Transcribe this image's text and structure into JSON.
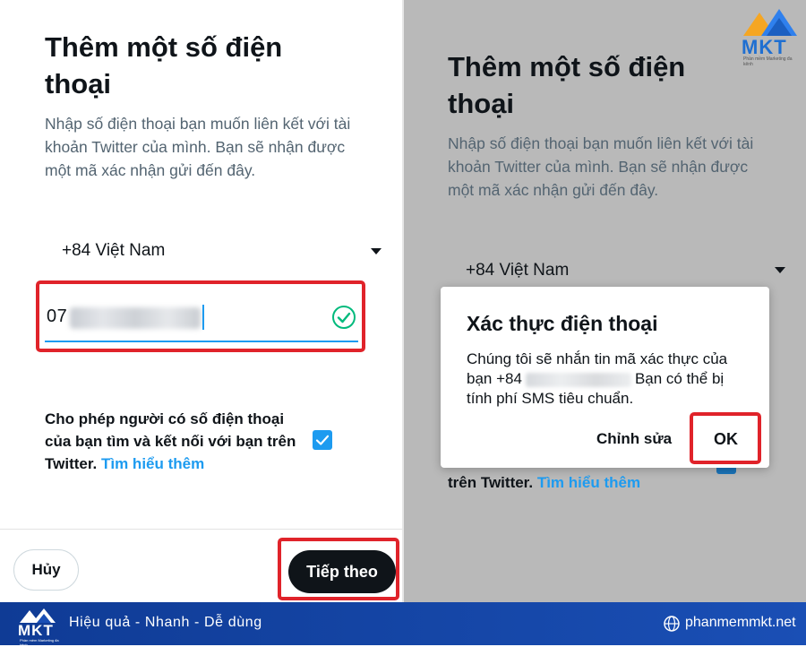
{
  "left_screen": {
    "title": "Thêm một số điện thoại",
    "description": "Nhập số điện thoại bạn muốn liên kết với tài khoản Twitter của mình. Bạn sẽ nhận được một mã xác nhận gửi đến đây.",
    "country": "+84 Việt Nam",
    "phone_visible": "07",
    "permission_text": "Cho phép người có số điện thoại của bạn tìm và kết nối với bạn trên Twitter.",
    "learn_more": "Tìm hiểu thêm",
    "cancel_label": "Hủy",
    "next_label": "Tiếp theo"
  },
  "right_screen": {
    "title": "Thêm một số điện thoại",
    "description": "Nhập số điện thoại bạn muốn liên kết với tài khoản Twitter của mình. Bạn sẽ nhận được một mã xác nhận gửi đến đây.",
    "country": "+84 Việt Nam",
    "permission_text_visible": "trên Twitter.",
    "learn_more": "Tìm hiểu thêm",
    "dialog": {
      "title": "Xác thực điện thoại",
      "body_before": "Chúng tôi sẽ nhắn tin mã xác thực của bạn +84",
      "body_after": "Bạn có thể bị tính phí SMS tiêu chuẩn.",
      "edit_label": "Chỉnh sửa",
      "ok_label": "OK"
    }
  },
  "brand": {
    "logo_text": "MKT",
    "logo_tagline": "Phần mềm Marketing đa kênh",
    "slogan": "Hiệu quả - Nhanh  - Dễ dùng",
    "website": "phanmemmkt.net"
  },
  "colors": {
    "twitter_blue": "#1d9bf0",
    "highlight_red": "#e0232a",
    "brand_blue": "#1a4fb5",
    "dim_gray": "#b9b9b9"
  }
}
